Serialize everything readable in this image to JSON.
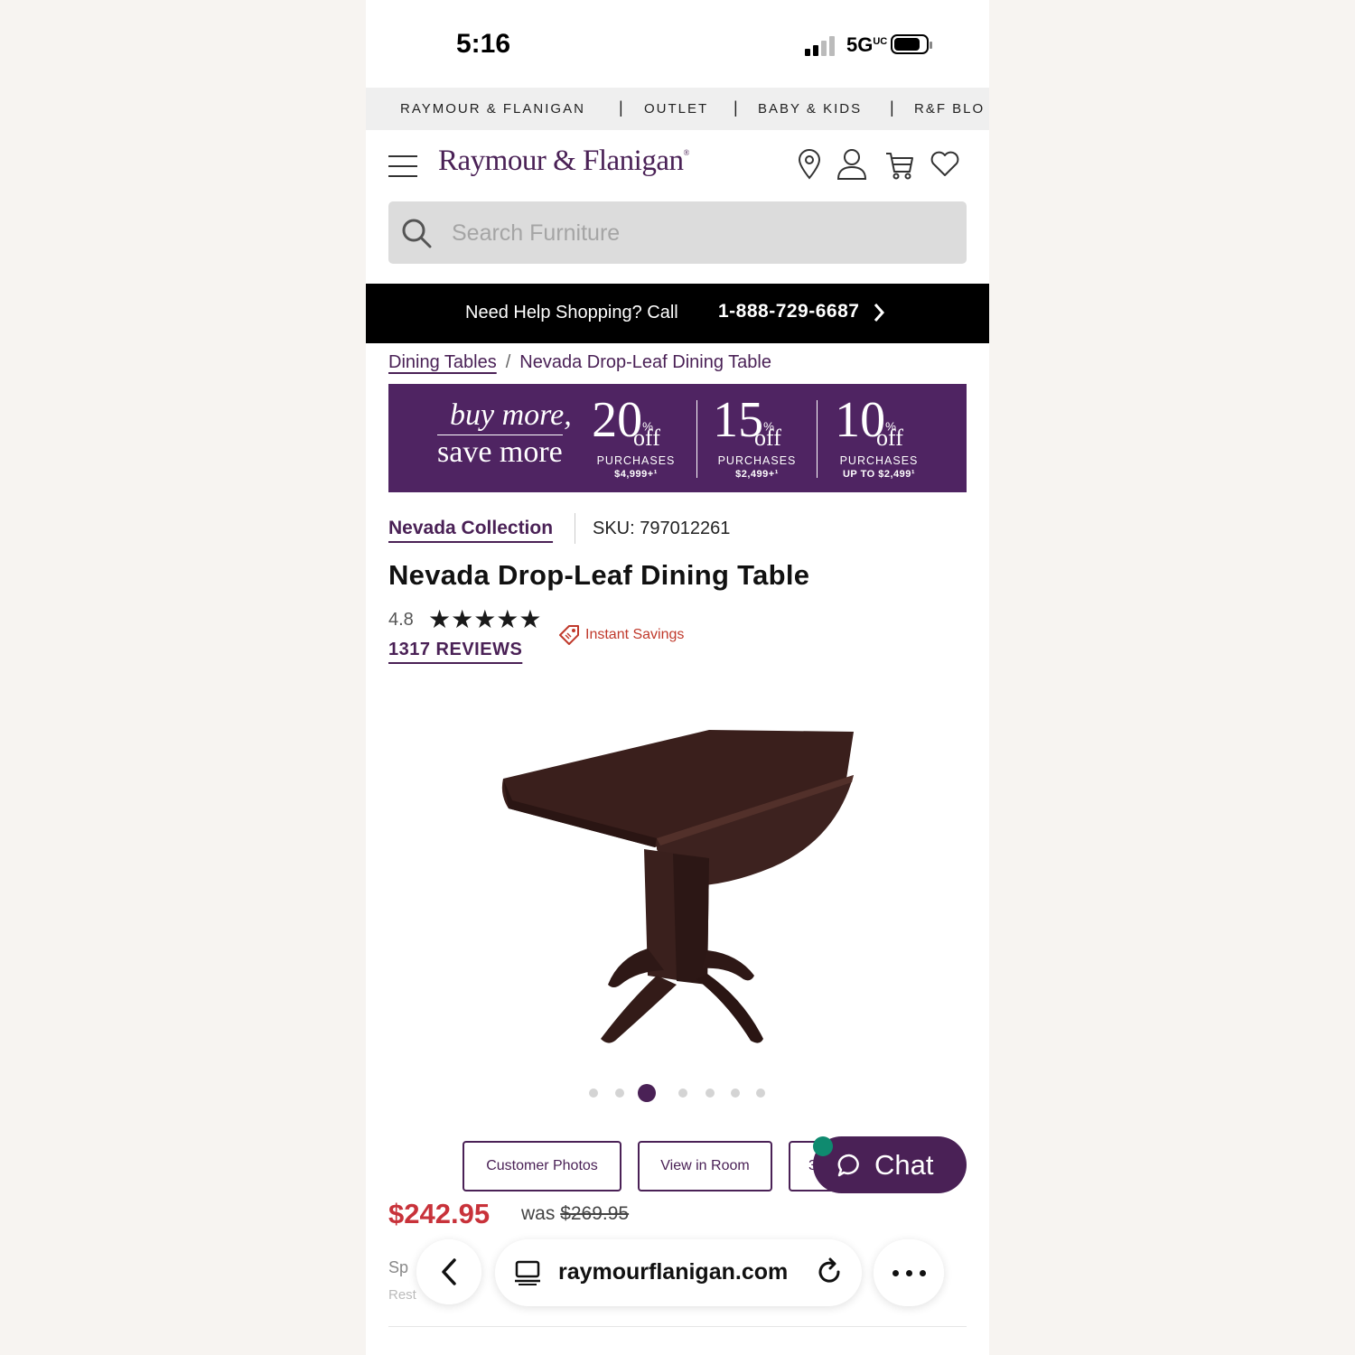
{
  "status_bar": {
    "time": "5:16",
    "network": "5G",
    "network_sub": "UC"
  },
  "site_nav": [
    "RAYMOUR & FLANIGAN",
    "OUTLET",
    "BABY & KIDS",
    "R&F BLO"
  ],
  "header": {
    "logo": "Raymour & Flanigan",
    "logo_mark": "®",
    "icons": [
      "location-pin-icon",
      "account-icon",
      "cart-icon",
      "wishlist-heart-icon"
    ]
  },
  "search": {
    "placeholder": "Search Furniture",
    "value": ""
  },
  "help_bar": {
    "text": "Need Help Shopping? Call",
    "phone": "1-888-729-6687"
  },
  "breadcrumb": {
    "parent": "Dining Tables",
    "separator": "/",
    "current": "Nevada Drop-Leaf Dining Table"
  },
  "promo": {
    "tagline_1": "buy more,",
    "tagline_2": "save more",
    "tiers": [
      {
        "percent": "20",
        "symbol": "%",
        "off": "off",
        "label": "PURCHASES",
        "condition": "$4,999+¹"
      },
      {
        "percent": "15",
        "symbol": "%",
        "off": "off",
        "label": "PURCHASES",
        "condition": "$2,499+¹"
      },
      {
        "percent": "10",
        "symbol": "%",
        "off": "off",
        "label": "PURCHASES",
        "condition": "UP TO $2,499¹"
      }
    ]
  },
  "product": {
    "collection": "Nevada Collection",
    "sku": "SKU: 797012261",
    "title": "Nevada Drop-Leaf Dining Table",
    "rating": "4.8",
    "stars": "★★★★★",
    "stars_value": 4.8,
    "reviews": "1317 REVIEWS",
    "instant_savings": "Instant Savings",
    "price": "$242.95",
    "was_label": "was",
    "was_price": "$269.95",
    "faded_line_1": "Sp",
    "faded_line_2": "Rest"
  },
  "carousel": {
    "count": 7,
    "active_index": 2
  },
  "actions": {
    "customer_photos": "Customer Photos",
    "view_in_room": "View in Room",
    "third_partial": "3"
  },
  "chat": {
    "label": "Chat"
  },
  "browser": {
    "url": "raymourflanigan.com"
  },
  "colors": {
    "brand_purple": "#4a2156",
    "price_red": "#c8323a",
    "chat_dot": "#0f8a6f"
  }
}
